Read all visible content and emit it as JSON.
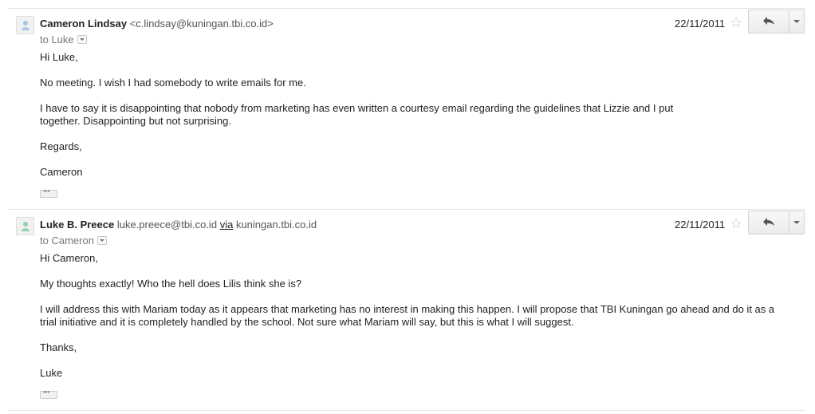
{
  "messages": [
    {
      "sender_name": "Cameron Lindsay",
      "sender_email": "<c.lindsay@kuningan.tbi.co.id>",
      "to_line": "to Luke",
      "date": "22/11/2011",
      "body": [
        "Hi Luke,",
        "No meeting. I wish I had somebody to write emails for me.",
        "I have to say it is disappointing that nobody from marketing has even written a courtesy email regarding the guidelines that Lizzie and I put together. Disappointing but not surprising.",
        "Regards,",
        "Cameron"
      ],
      "avatar_color": "#a5c6e6"
    },
    {
      "sender_name": "Luke B. Preece",
      "sender_email": "luke.preece@tbi.co.id",
      "via_label": "via",
      "via_domain": "kuningan.tbi.co.id",
      "to_line": "to Cameron",
      "date": "22/11/2011",
      "body": [
        "Hi Cameron,",
        "My thoughts exactly! Who the hell does Lilis think she is?",
        "I will address this with Mariam today as it appears that marketing has no interest in making this happen. I will propose that TBI Kuningan go ahead and do it as a trial initiative and it is completely handled by the school. Not sure what Mariam will say, but this is what I will suggest.",
        "Thanks,",
        "Luke"
      ],
      "avatar_color": "#8fd0b0"
    }
  ],
  "icons": {
    "star": "☆",
    "reply": "reply-arrow-icon",
    "more": "chevron-down-icon",
    "avatar": "person-icon"
  }
}
